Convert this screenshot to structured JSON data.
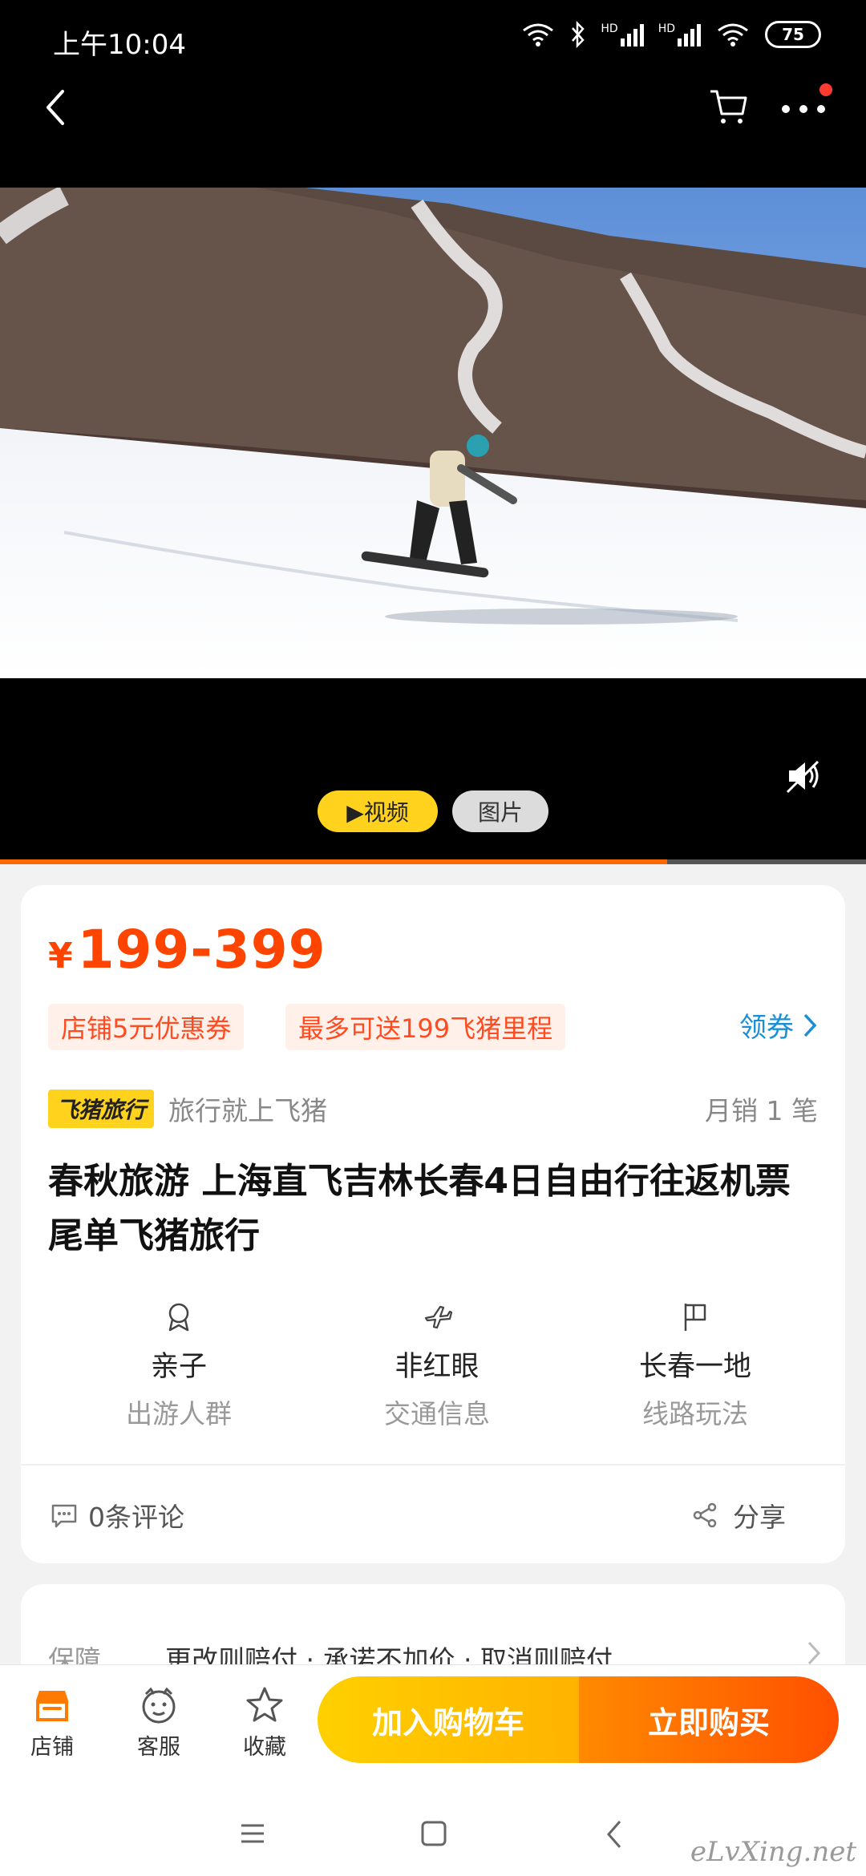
{
  "status_bar": {
    "time": "上午10:04",
    "battery": "75",
    "hd1": "HD",
    "hd2": "HD"
  },
  "media": {
    "tabs": {
      "video": "▶视频",
      "photos": "图片"
    },
    "progress": 0.77
  },
  "product": {
    "currency": "¥",
    "price": "199-399",
    "coupons": [
      "店铺5元优惠券",
      "最多可送199飞猪里程"
    ],
    "get_coupon": "领券",
    "brand": "飞猪旅行",
    "slogan": "旅行就上飞猪",
    "monthly_sales": "月销 1 笔",
    "title": "春秋旅游  上海直飞吉林长春4日自由行往返机票尾单飞猪旅行",
    "attributes": [
      {
        "value": "亲子",
        "label": "出游人群",
        "icon": "badge-icon"
      },
      {
        "value": "非红眼",
        "label": "交通信息",
        "icon": "airplane-icon"
      },
      {
        "value": "长春一地",
        "label": "线路玩法",
        "icon": "flag-icon"
      }
    ],
    "comments": "0条评论",
    "share": "分享"
  },
  "guarantee": {
    "label": "保障",
    "text": "更改则赔付 · 承诺不加价 · 取消则赔付"
  },
  "action_bar": {
    "shop": "店铺",
    "service": "客服",
    "favorite": "收藏",
    "add_to_cart": "加入购物车",
    "buy_now": "立即购买"
  },
  "watermark": "eLvXing.net",
  "colors": {
    "accent": "#ff4400",
    "link": "#1a8fd6",
    "yellow": "#ffd21e"
  }
}
